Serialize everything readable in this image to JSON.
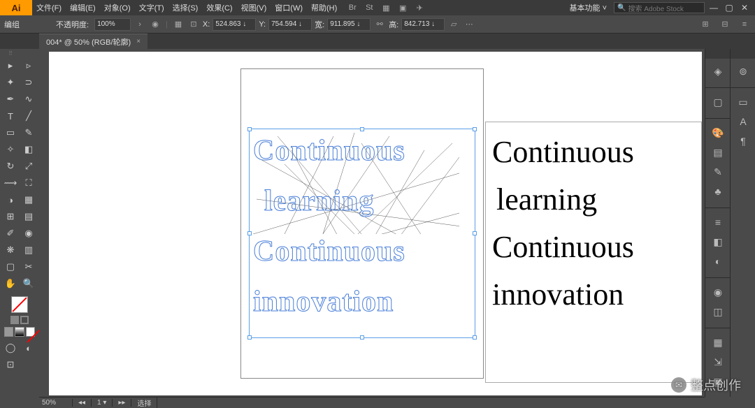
{
  "menu": {
    "items": [
      "文件(F)",
      "编辑(E)",
      "对象(O)",
      "文字(T)",
      "选择(S)",
      "效果(C)",
      "视图(V)",
      "窗口(W)",
      "帮助(H)"
    ],
    "workspace": "基本功能",
    "search_placeholder": "搜索 Adobe Stock"
  },
  "control": {
    "mode": "编组",
    "opacity_label": "不透明度:",
    "opacity": "100%",
    "x_label": "X:",
    "x": "524.863 ↓",
    "y_label": "Y:",
    "y": "754.594 ↓",
    "w_label": "宽:",
    "w": "911.895 ↓",
    "h_label": "高:",
    "h": "842.713 ↓"
  },
  "tab": {
    "label": "004* @ 50% (RGB/轮廓)"
  },
  "canvas": {
    "text_lines": [
      "Continuous",
      "learning",
      "Continuous",
      "innovation"
    ]
  },
  "status": {
    "zoom": "50%",
    "tool": "选择"
  },
  "watermark": "整点创作"
}
